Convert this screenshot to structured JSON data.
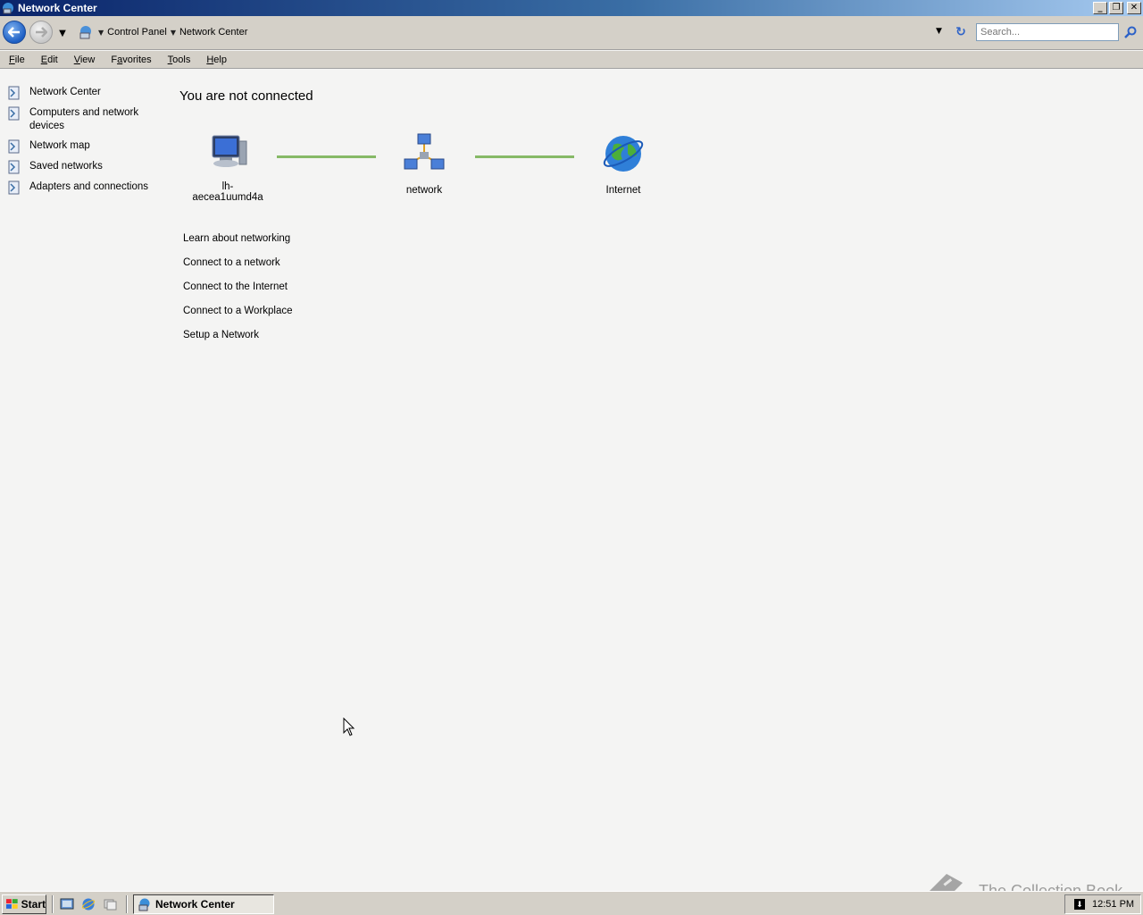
{
  "window": {
    "title": "Network Center",
    "controls": {
      "minimize": "_",
      "restore": "❐",
      "close": "✕"
    }
  },
  "address": {
    "breadcrumbs": [
      "Control Panel",
      "Network Center"
    ],
    "search_placeholder": "Search..."
  },
  "menu": [
    {
      "label": "File",
      "underline": "F"
    },
    {
      "label": "Edit",
      "underline": "E"
    },
    {
      "label": "View",
      "underline": "V"
    },
    {
      "label": "Favorites",
      "underline": "a"
    },
    {
      "label": "Tools",
      "underline": "T"
    },
    {
      "label": "Help",
      "underline": "H"
    }
  ],
  "sidebar": {
    "items": [
      {
        "label": "Network Center",
        "icon": "page-icon"
      },
      {
        "label": "Computers and network devices",
        "icon": "page-icon"
      },
      {
        "label": "Network map",
        "icon": "page-icon"
      },
      {
        "label": "Saved networks",
        "icon": "page-icon"
      },
      {
        "label": "Adapters and connections",
        "icon": "page-icon"
      }
    ]
  },
  "main": {
    "headline": "You are not connected",
    "nodes": [
      {
        "label": "lh-aecea1uumd4a",
        "icon": "computer-icon"
      },
      {
        "label": "network",
        "icon": "network-icon"
      },
      {
        "label": "Internet",
        "icon": "globe-icon"
      }
    ],
    "tasks": [
      "Learn about networking",
      "Connect to a network",
      "Connect to the Internet",
      "Connect to a Workplace",
      "Setup a Network"
    ]
  },
  "taskbar": {
    "start_label": "Start",
    "active_task": "Network Center",
    "clock": "12:51 PM"
  },
  "watermark": "The Collection Book",
  "colors": {
    "title_gradient_start": "#0a246a",
    "title_gradient_end": "#a6caf0",
    "link_line": "#86b966",
    "chrome": "#d4d0c8",
    "content_bg": "#f4f4f3"
  }
}
